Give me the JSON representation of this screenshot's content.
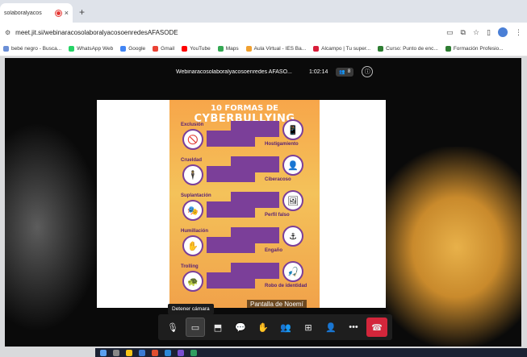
{
  "browser": {
    "tab_title": "solaboralyacos",
    "tab_close": "×",
    "new_tab": "+",
    "url": "meet.jit.si/webinaracosolaboralyacosoenredesAFASODE",
    "bookmarks": [
      {
        "label": "bebé negro - Busca...",
        "color": "#6b8fd6"
      },
      {
        "label": "WhatsApp Web",
        "color": "#25d366"
      },
      {
        "label": "Google",
        "color": "#4285f4"
      },
      {
        "label": "Gmail",
        "color": "#ea4335"
      },
      {
        "label": "YouTube",
        "color": "#ff0000"
      },
      {
        "label": "Maps",
        "color": "#34a853"
      },
      {
        "label": "Aula Virtual - IES Ba...",
        "color": "#f0a030"
      },
      {
        "label": "Alcampo | Tu super...",
        "color": "#d81e3a"
      },
      {
        "label": "Curso: Punto de enc...",
        "color": "#2e7d32"
      },
      {
        "label": "Formación Profesio...",
        "color": "#2e7d32"
      }
    ]
  },
  "meeting": {
    "title": "Webinaracosolaboralyacosoenredes AFASO...",
    "duration": "1:02:14",
    "participants_badge": "8"
  },
  "infographic": {
    "title_line1": "10 FORMAS DE",
    "title_line2": "CYBERBULLYING",
    "items": [
      {
        "label": "Exclusión",
        "icon": "🚫"
      },
      {
        "label": "Hostigamiento",
        "icon": "📱"
      },
      {
        "label": "Crueldad",
        "icon": "🕴"
      },
      {
        "label": "Ciberacoso",
        "icon": "👤"
      },
      {
        "label": "Suplantación",
        "icon": "🎭"
      },
      {
        "label": "Perfil falso",
        "icon": "🖼"
      },
      {
        "label": "Humillación",
        "icon": "✋"
      },
      {
        "label": "Engaño",
        "icon": "⚓"
      },
      {
        "label": "Trolling",
        "icon": "🐢"
      },
      {
        "label": "Robo de identidad",
        "icon": "🎣"
      }
    ]
  },
  "tooltip": "Detener cámara",
  "presenter_label": "Pantalla de Noemí",
  "colors": {
    "hangup": "#d3263b",
    "accent_purple": "#7b3f99",
    "infographic_orange": "#f7a64a"
  }
}
